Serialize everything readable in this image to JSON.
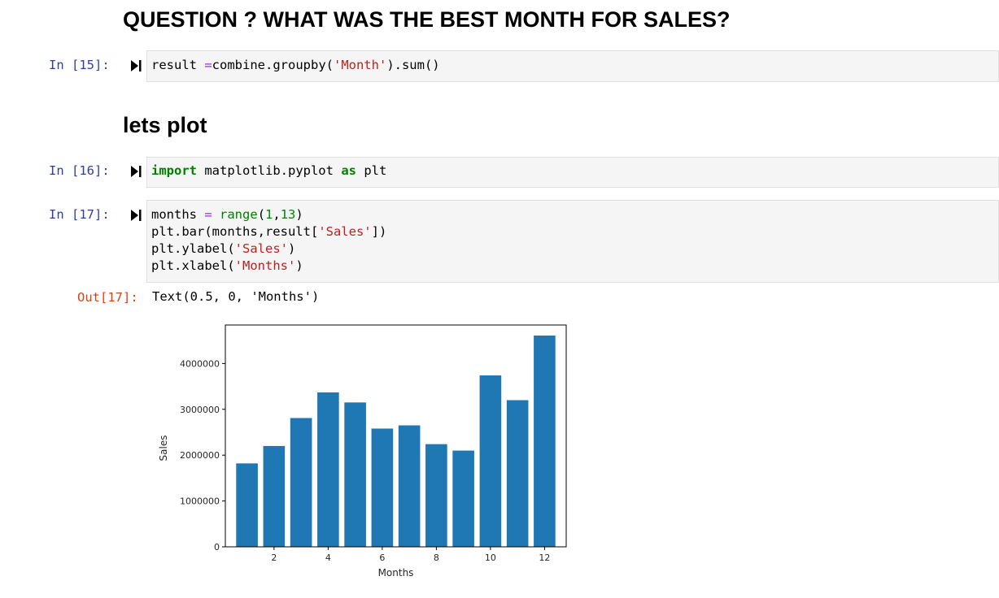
{
  "heading_question": "QUESTION ? WHAT WAS THE BEST MONTH FOR SALES?",
  "heading_plot": "lets plot",
  "cells": [
    {
      "prompt": "In [15]:"
    },
    {
      "prompt": "In [16]:"
    },
    {
      "prompt": "In [17]:"
    }
  ],
  "code15": {
    "p1": "result ",
    "p2": "=",
    "p3": "combine.groupby(",
    "p4": "'Month'",
    "p5": ").sum()"
  },
  "code16": {
    "kw1": "import",
    "p1": " matplotlib.pyplot ",
    "kw2": "as",
    "p2": " plt"
  },
  "code17": {
    "l1": {
      "a": "months ",
      "b": "=",
      "c": " ",
      "d": "range",
      "e": "(",
      "f": "1",
      "g": ",",
      "h": "13",
      "i": ")"
    },
    "l2": {
      "a": "plt.bar(months,result[",
      "b": "'Sales'",
      "c": "])"
    },
    "l3": {
      "a": "plt.ylabel(",
      "b": "'Sales'",
      "c": ")"
    },
    "l4": {
      "a": "plt.xlabel(",
      "b": "'Months'",
      "c": ")"
    }
  },
  "output17": {
    "prompt": "Out[17]:",
    "text": "Text(0.5, 0, 'Months')"
  },
  "colors": {
    "bar": "#1f77b4",
    "in_prompt": "#303f9f",
    "out_prompt": "#d84315",
    "keyword": "#008000",
    "string": "#ba2121",
    "operator": "#aa22ff"
  },
  "icons": {
    "run": "step-run-icon"
  },
  "chart_data": {
    "type": "bar",
    "x": [
      1,
      2,
      3,
      4,
      5,
      6,
      7,
      8,
      9,
      10,
      11,
      12
    ],
    "values": [
      1820000,
      2200000,
      2810000,
      3370000,
      3150000,
      2580000,
      2650000,
      2240000,
      2100000,
      3740000,
      3200000,
      4610000
    ],
    "xticks": [
      2,
      4,
      6,
      8,
      10,
      12
    ],
    "yticks": [
      0,
      1000000,
      2000000,
      3000000,
      4000000
    ],
    "xlabel": "Months",
    "ylabel": "Sales",
    "xlim": [
      0.2,
      12.8
    ],
    "ylim": [
      0,
      4840000
    ],
    "grid": false
  }
}
